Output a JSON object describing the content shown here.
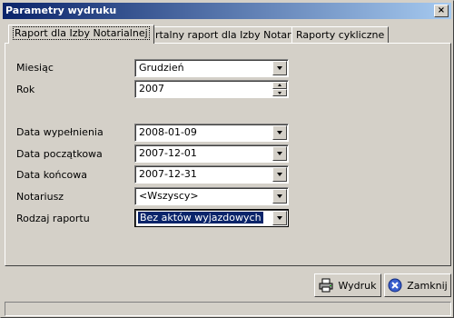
{
  "window": {
    "title": "Parametry wydruku",
    "close_label": "×"
  },
  "tabs": [
    {
      "label": "Raport dla Izby Notarialnej",
      "active": true
    },
    {
      "label": "Kwartalny raport dla Izby Notarialnej",
      "active": false
    },
    {
      "label": "Raporty cykliczne",
      "active": false
    }
  ],
  "form": {
    "miesiac": {
      "label": "Miesiąc",
      "value": "Grudzień"
    },
    "rok": {
      "label": "Rok",
      "value": "2007"
    },
    "data_wypelnienia": {
      "label": "Data wypełnienia",
      "value": "2008-01-09"
    },
    "data_poczatkowa": {
      "label": "Data początkowa",
      "value": "2007-12-01"
    },
    "data_koncowa": {
      "label": "Data końcowa",
      "value": "2007-12-31"
    },
    "notariusz": {
      "label": "Notariusz",
      "value": "<Wszyscy>"
    },
    "rodzaj_raportu": {
      "label": "Rodzaj raportu",
      "value": "Bez aktów wyjazdowych"
    }
  },
  "buttons": {
    "print": {
      "label": "Wydruk",
      "icon": "printer-icon"
    },
    "close": {
      "label": "Zamknij",
      "icon": "close-circle-icon"
    }
  },
  "colors": {
    "titlebar_start": "#0a246a",
    "titlebar_end": "#a6caf0",
    "face": "#d4d0c8",
    "selection": "#0a246a"
  }
}
